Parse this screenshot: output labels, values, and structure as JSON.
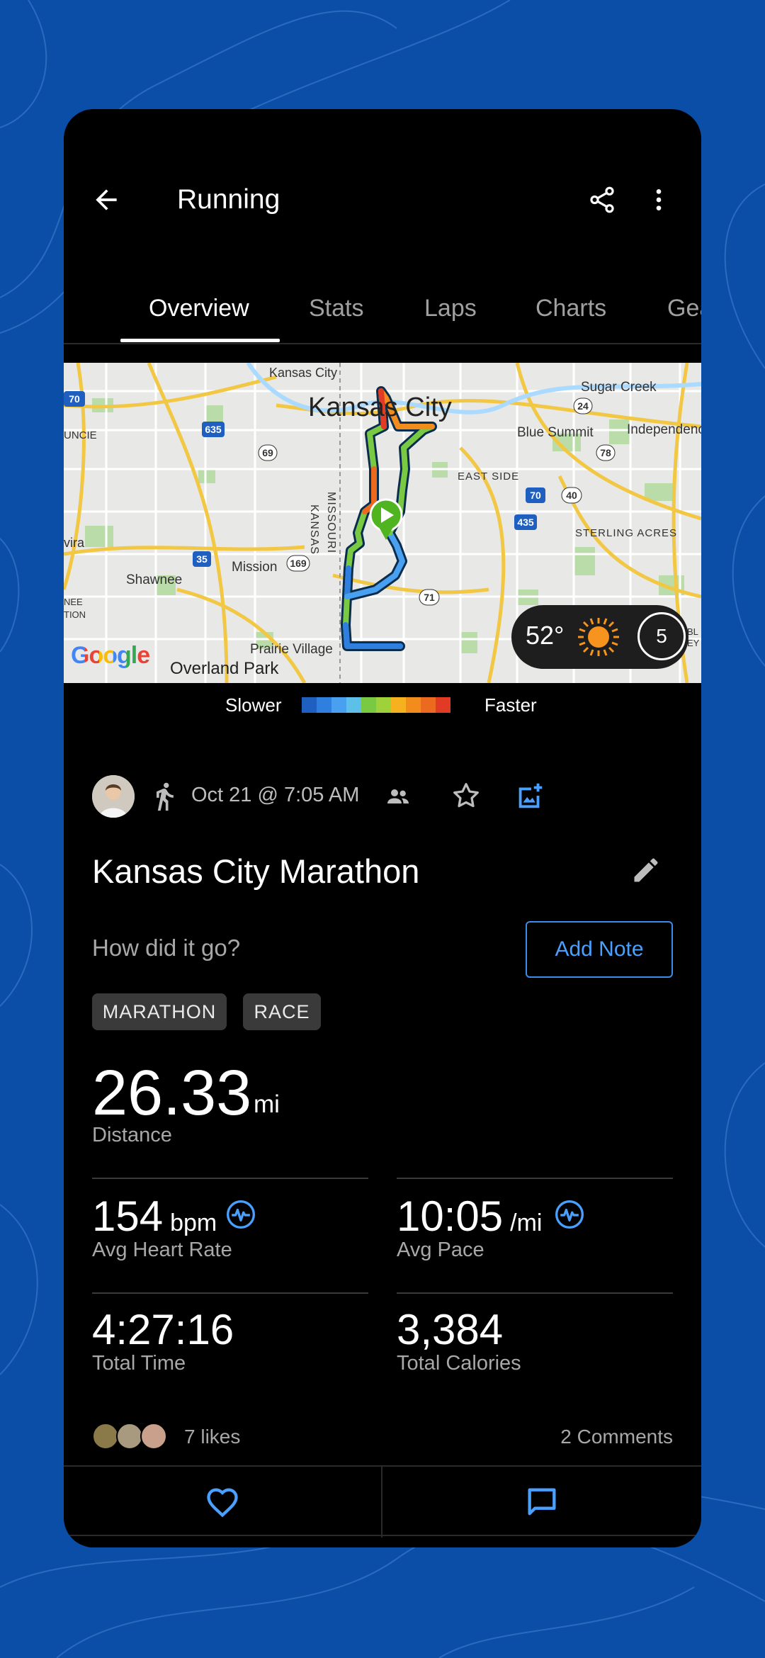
{
  "colors": {
    "background": "#0b4ea8",
    "accent": "#4aa0ff",
    "surface": "#000000",
    "chip": "#3a3a3a"
  },
  "app_bar": {
    "title": "Running",
    "back_icon": "arrow-left-icon",
    "share_icon": "share-icon",
    "more_icon": "more-vertical-icon"
  },
  "tabs": [
    {
      "label": "Overview",
      "active": true
    },
    {
      "label": "Stats",
      "active": false
    },
    {
      "label": "Laps",
      "active": false
    },
    {
      "label": "Charts",
      "active": false
    },
    {
      "label": "Gea",
      "active": false
    }
  ],
  "map": {
    "labels": [
      "Kansas City",
      "Kansas City",
      "Sugar Creek",
      "Blue Summit",
      "Independenc",
      "UNCIE",
      "EAST SIDE",
      "STERLING ACRES",
      "vira",
      "Shawnee",
      "Mission",
      "NEE",
      "TION",
      "Prairie Village",
      "Overland Park",
      "MISSOURI",
      "KANSAS",
      "BL",
      "EY"
    ],
    "route_shields": [
      "70",
      "635",
      "24",
      "69",
      "78",
      "70",
      "40",
      "435",
      "35",
      "169",
      "71"
    ],
    "logo_text": "Google",
    "weather": {
      "temperature": "52°",
      "condition_icon": "sun-icon",
      "wind_value": "5"
    }
  },
  "legend": {
    "slower": "Slower",
    "faster": "Faster",
    "colors": [
      "#1f5fbf",
      "#2f7fe0",
      "#4aa0f0",
      "#5cc0e8",
      "#7ac943",
      "#9fd23a",
      "#f5b21e",
      "#f28c1d",
      "#ec6a1f",
      "#e23b25"
    ]
  },
  "activity": {
    "activity_icon": "running-icon",
    "date": "Oct 21 @ 7:05 AM",
    "title": "Kansas City Marathon",
    "prompt": "How did it go?",
    "add_note": "Add Note",
    "tags": [
      "MARATHON",
      "RACE"
    ]
  },
  "stats": {
    "distance": {
      "value": "26.33",
      "unit": "mi",
      "label": "Distance"
    },
    "heart_rate": {
      "value": "154",
      "unit": "bpm",
      "label": "Avg Heart Rate"
    },
    "pace": {
      "value": "10:05",
      "unit": "/mi",
      "label": "Avg Pace"
    },
    "time": {
      "value": "4:27:16",
      "label": "Total Time"
    },
    "calories": {
      "value": "3,384",
      "label": "Total Calories"
    }
  },
  "social": {
    "likes": "7 likes",
    "comments": "2 Comments"
  }
}
